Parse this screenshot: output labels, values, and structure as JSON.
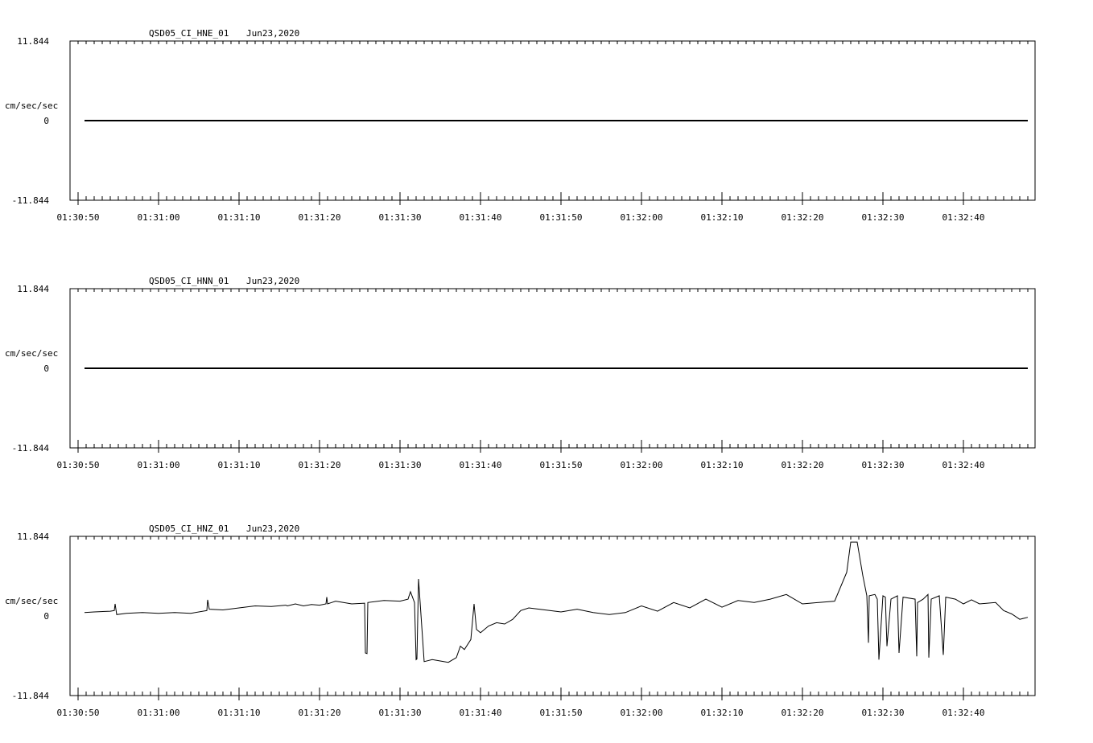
{
  "panels": [
    {
      "station": "QSD05_CI_HNE_01",
      "date": "Jun23,2020",
      "y_unit": "cm/sec/sec",
      "y_ticks": [
        "11.844",
        "0",
        "-11.844"
      ],
      "x_ticks": [
        "01:30:50",
        "01:31:00",
        "01:31:10",
        "01:31:20",
        "01:31:30",
        "01:31:40",
        "01:31:50",
        "01:32:00",
        "01:32:10",
        "01:32:20",
        "01:32:30",
        "01:32:40"
      ]
    },
    {
      "station": "QSD05_CI_HNN_01",
      "date": "Jun23,2020",
      "y_unit": "cm/sec/sec",
      "y_ticks": [
        "11.844",
        "0",
        "-11.844"
      ],
      "x_ticks": [
        "01:30:50",
        "01:31:00",
        "01:31:10",
        "01:31:20",
        "01:31:30",
        "01:31:40",
        "01:31:50",
        "01:32:00",
        "01:32:10",
        "01:32:20",
        "01:32:30",
        "01:32:40"
      ]
    },
    {
      "station": "QSD05_CI_HNZ_01",
      "date": "Jun23,2020",
      "y_unit": "cm/sec/sec",
      "y_ticks": [
        "11.844",
        "0",
        "-11.844"
      ],
      "x_ticks": [
        "01:30:50",
        "01:31:00",
        "01:31:10",
        "01:31:20",
        "01:31:30",
        "01:31:40",
        "01:31:50",
        "01:32:00",
        "01:32:10",
        "01:32:20",
        "01:32:30",
        "01:32:40"
      ]
    }
  ],
  "chart_data": [
    {
      "type": "line",
      "title": "QSD05_CI_HNE_01  Jun23,2020",
      "ylabel": "cm/sec/sec",
      "ylim": [
        -11.844,
        11.844
      ],
      "x_unit": "seconds after 01:30:50",
      "xlim": [
        -1,
        118
      ],
      "series": [
        {
          "x": [
            0.8,
            118
          ],
          "y": [
            0,
            0
          ]
        }
      ]
    },
    {
      "type": "line",
      "title": "QSD05_CI_HNN_01  Jun23,2020",
      "ylabel": "cm/sec/sec",
      "ylim": [
        -11.844,
        11.844
      ],
      "x_unit": "seconds after 01:30:50",
      "xlim": [
        -1,
        118
      ],
      "series": [
        {
          "x": [
            0.8,
            118
          ],
          "y": [
            0,
            0
          ]
        }
      ]
    },
    {
      "type": "line",
      "title": "QSD05_CI_HNZ_01  Jun23,2020",
      "ylabel": "cm/sec/sec",
      "ylim": [
        -11.844,
        11.844
      ],
      "x_unit": "seconds after 01:30:50",
      "xlim": [
        -1,
        118
      ],
      "series": [
        {
          "x": [
            0.8,
            2.0,
            4.0,
            4.5,
            4.6,
            4.8,
            6.0,
            8.0,
            10.0,
            12.0,
            14.0,
            16.0,
            16.1,
            16.3,
            18.0,
            20.0,
            22.0,
            24.0,
            25.8,
            26.0,
            27.0,
            28.0,
            29.0,
            30.0,
            30.8,
            30.9,
            31.0,
            31.5,
            32.0,
            34.0,
            35.6,
            35.7,
            35.9,
            36.0,
            38.0,
            40.0,
            41.0,
            41.1,
            41.3,
            41.8,
            42.0,
            42.1,
            42.3,
            43.0,
            44.0,
            45.0,
            46.0,
            47.0,
            47.5,
            48.0,
            48.8,
            49.2,
            49.5,
            50.0,
            51.0,
            52.0,
            53.0,
            54.0,
            55.0,
            56.0,
            58.0,
            60.0,
            62.0,
            64.0,
            66.0,
            68.0,
            70.0,
            72.0,
            74.0,
            76.0,
            78.0,
            80.0,
            82.0,
            84.0,
            86.0,
            88.0,
            90.0,
            94.0,
            95.5,
            96.0,
            96.8,
            97.5,
            98.0,
            98.2,
            98.3,
            99.0,
            99.3,
            99.5,
            100.0,
            100.3,
            100.5,
            101.0,
            101.8,
            102.0,
            102.5,
            104.0,
            104.2,
            104.3,
            105.0,
            105.6,
            105.7,
            106.0,
            107.0,
            107.5,
            107.8,
            109.0,
            110.0,
            111.0,
            112.0,
            114.0,
            115.0,
            116.0,
            117.0,
            118.0
          ],
          "y": [
            0.5,
            0.6,
            0.7,
            0.8,
            1.8,
            0.2,
            0.4,
            0.5,
            0.4,
            0.5,
            0.4,
            0.8,
            2.4,
            1.0,
            0.9,
            1.2,
            1.5,
            1.4,
            1.6,
            1.5,
            1.8,
            1.5,
            1.7,
            1.6,
            1.8,
            2.8,
            1.8,
            2.0,
            2.2,
            1.8,
            1.9,
            -5.5,
            -5.6,
            2.0,
            2.3,
            2.2,
            2.5,
            2.9,
            3.6,
            2.0,
            -6.5,
            -6.4,
            5.5,
            -6.8,
            -6.5,
            -6.7,
            -6.9,
            -6.2,
            -4.5,
            -5.0,
            -3.5,
            1.8,
            -2.0,
            -2.5,
            -1.5,
            -1.0,
            -1.2,
            -0.5,
            0.8,
            1.2,
            0.9,
            0.6,
            1.0,
            0.5,
            0.2,
            0.5,
            1.5,
            0.7,
            2.0,
            1.2,
            2.5,
            1.3,
            2.3,
            2.0,
            2.5,
            3.2,
            1.8,
            2.2,
            6.5,
            11.0,
            11.0,
            6.0,
            3.0,
            -4.0,
            3.0,
            3.2,
            2.5,
            -6.5,
            3.0,
            2.8,
            -4.5,
            2.5,
            3.0,
            -5.5,
            2.8,
            2.5,
            -6.0,
            2.0,
            2.5,
            3.2,
            -6.2,
            2.5,
            3.0,
            -5.8,
            2.8,
            2.5,
            1.8,
            2.4,
            1.8,
            2.0,
            0.8,
            0.3,
            -0.5,
            -0.2
          ]
        }
      ]
    }
  ]
}
